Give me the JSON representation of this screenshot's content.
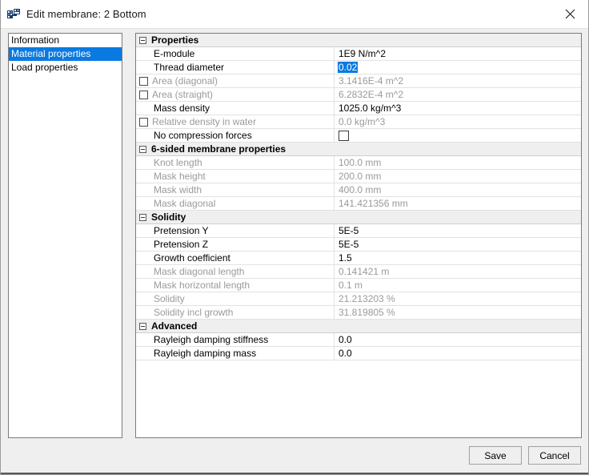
{
  "window": {
    "title": "Edit membrane: 2 Bottom",
    "icon": "membrane-app-icon",
    "close_icon": "close-icon"
  },
  "sidebar": {
    "items": [
      {
        "label": "Information",
        "selected": false
      },
      {
        "label": "Material properties",
        "selected": true
      },
      {
        "label": "Load properties",
        "selected": false
      }
    ]
  },
  "grid": {
    "sections": [
      {
        "title": "Properties",
        "rows": [
          {
            "label": "E-module",
            "value": "1E9 N/m^2",
            "dim": false,
            "checkbox": false,
            "value_checkbox": false,
            "editing": false
          },
          {
            "label": "Thread diameter",
            "value": "0.02",
            "dim": false,
            "checkbox": false,
            "value_checkbox": false,
            "editing": true
          },
          {
            "label": "Area (diagonal)",
            "value": "3.1416E-4 m^2",
            "dim": true,
            "checkbox": true,
            "value_checkbox": false,
            "editing": false
          },
          {
            "label": "Area (straight)",
            "value": "6.2832E-4 m^2",
            "dim": true,
            "checkbox": true,
            "value_checkbox": false,
            "editing": false
          },
          {
            "label": "Mass density",
            "value": "1025.0 kg/m^3",
            "dim": false,
            "checkbox": false,
            "value_checkbox": false,
            "editing": false
          },
          {
            "label": "Relative density in water",
            "value": "0.0 kg/m^3",
            "dim": true,
            "checkbox": true,
            "value_checkbox": false,
            "editing": false
          },
          {
            "label": "No compression forces",
            "value": "",
            "dim": false,
            "checkbox": false,
            "value_checkbox": true,
            "editing": false
          }
        ]
      },
      {
        "title": "6-sided membrane properties",
        "rows": [
          {
            "label": "Knot length",
            "value": "100.0 mm",
            "dim": true,
            "checkbox": false,
            "value_checkbox": false,
            "editing": false
          },
          {
            "label": "Mask height",
            "value": "200.0 mm",
            "dim": true,
            "checkbox": false,
            "value_checkbox": false,
            "editing": false
          },
          {
            "label": "Mask width",
            "value": "400.0 mm",
            "dim": true,
            "checkbox": false,
            "value_checkbox": false,
            "editing": false
          },
          {
            "label": "Mask diagonal",
            "value": "141.421356 mm",
            "dim": true,
            "checkbox": false,
            "value_checkbox": false,
            "editing": false
          }
        ]
      },
      {
        "title": "Solidity",
        "rows": [
          {
            "label": "Pretension Y",
            "value": "5E-5",
            "dim": false,
            "checkbox": false,
            "value_checkbox": false,
            "editing": false
          },
          {
            "label": "Pretension Z",
            "value": "5E-5",
            "dim": false,
            "checkbox": false,
            "value_checkbox": false,
            "editing": false
          },
          {
            "label": "Growth coefficient",
            "value": "1.5",
            "dim": false,
            "checkbox": false,
            "value_checkbox": false,
            "editing": false
          },
          {
            "label": "Mask diagonal length",
            "value": "0.141421 m",
            "dim": true,
            "checkbox": false,
            "value_checkbox": false,
            "editing": false
          },
          {
            "label": "Mask horizontal length",
            "value": "0.1 m",
            "dim": true,
            "checkbox": false,
            "value_checkbox": false,
            "editing": false
          },
          {
            "label": "Solidity",
            "value": "21.213203 %",
            "dim": true,
            "checkbox": false,
            "value_checkbox": false,
            "editing": false
          },
          {
            "label": "Solidity incl growth",
            "value": "31.819805 %",
            "dim": true,
            "checkbox": false,
            "value_checkbox": false,
            "editing": false
          }
        ]
      },
      {
        "title": "Advanced",
        "rows": [
          {
            "label": "Rayleigh damping stiffness",
            "value": "0.0",
            "dim": false,
            "checkbox": false,
            "value_checkbox": false,
            "editing": false
          },
          {
            "label": "Rayleigh damping mass",
            "value": "0.0",
            "dim": false,
            "checkbox": false,
            "value_checkbox": false,
            "editing": false
          }
        ]
      }
    ]
  },
  "footer": {
    "save_label": "Save",
    "cancel_label": "Cancel"
  },
  "colors": {
    "accent": "#0a7ae0",
    "section_bg": "#efefef",
    "dim_text": "#9a9a9a"
  }
}
